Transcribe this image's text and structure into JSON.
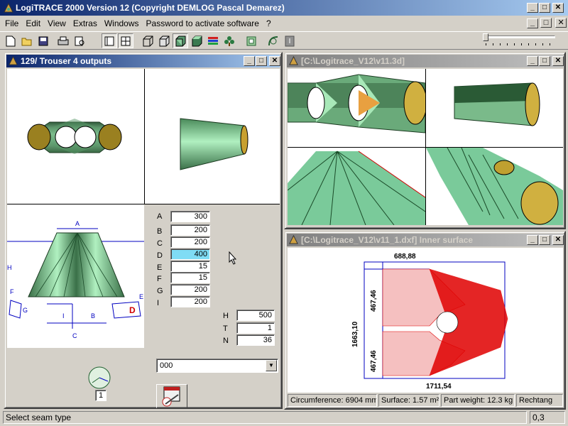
{
  "app": {
    "title": "LogiTRACE 2000  Version 12  (Copyright DEMLOG Pascal Demarez)"
  },
  "menu": [
    "File",
    "Edit",
    "View",
    "Extras",
    "Windows",
    "Password to activate software",
    "?"
  ],
  "toolbar": {
    "icons": [
      "new-icon",
      "open-icon",
      "save-icon",
      "print-icon",
      "preview-icon",
      "layout-icon",
      "wireframe-cube-icon",
      "box-cube-icon",
      "shaded-cube-icon",
      "solid-cube-icon",
      "color-map-icon",
      "tree-icon",
      "frame-icon",
      "curve-icon",
      "gray-tool-icon"
    ]
  },
  "left_window": {
    "title": "129/ Trouser 4 outputs",
    "params": [
      {
        "label": "A",
        "value": "300"
      },
      {
        "label": "B",
        "value": "200"
      },
      {
        "label": "C",
        "value": "200"
      },
      {
        "label": "D",
        "value": "400"
      },
      {
        "label": "E",
        "value": "15"
      },
      {
        "label": "F",
        "value": "15"
      },
      {
        "label": "G",
        "value": "200"
      },
      {
        "label": "I",
        "value": "200"
      }
    ],
    "extra": [
      {
        "label": "H",
        "value": "500"
      },
      {
        "label": "T",
        "value": "1"
      },
      {
        "label": "N",
        "value": "36"
      }
    ],
    "diagram_labels": {
      "a": "A",
      "b": "B",
      "c": "C",
      "d": "D",
      "f": "F",
      "g": "G",
      "i": "I",
      "e": "E",
      "h": "H"
    },
    "seam_value": "1",
    "dropdown_value": "000"
  },
  "win3d": {
    "title": "[C:\\Logitrace_V12\\v11.3d]"
  },
  "win_dxf": {
    "title": "[C:\\Logitrace_V12\\v11_1.dxf]  Inner surface",
    "dims": {
      "top": "688,88",
      "left_total": "1663,10",
      "left_upper": "467,46",
      "left_lower": "467,46",
      "bottom": "1711,54"
    },
    "status": {
      "circumference": "Circumference: 6904 mm",
      "surface": "Surface: 1.57 m²",
      "weight": "Part weight: 12.3 kg",
      "shape": "Rechtang"
    }
  },
  "statusbar": {
    "message": "Select seam type",
    "value": "0,3"
  },
  "colors": {
    "active_title": "#0a246a",
    "highlight_field": "#7fdcf5",
    "shape_green": "#7fcf9f",
    "dxf_red": "#e00000",
    "dxf_blue": "#0000c0"
  }
}
